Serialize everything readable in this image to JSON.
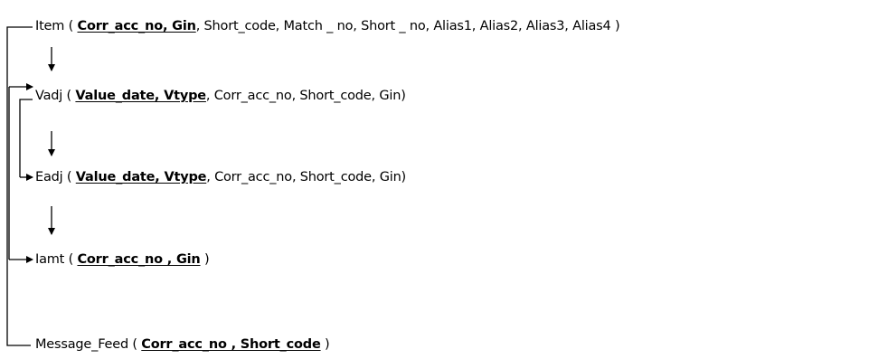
{
  "entities": [
    {
      "name": "Item",
      "key_fields": "Corr_acc_no, Gin",
      "other_fields": ", Short_code, Match _ no, Short _ no, Alias1, Alias2, Alias3, Alias4 )"
    },
    {
      "name": "Vadj",
      "key_fields": "Value_date, Vtype",
      "other_fields": ", Corr_acc_no, Short_code, Gin)"
    },
    {
      "name": "Eadj",
      "key_fields": "Value_date, Vtype",
      "other_fields": ", Corr_acc_no, Short_code, Gin)"
    },
    {
      "name": "Iamt",
      "key_fields": "Corr_acc_no , Gin",
      "other_fields": " )"
    },
    {
      "name": "Message_Feed",
      "key_fields": "Corr_acc_no , Short_code",
      "other_fields": " )"
    }
  ],
  "open_paren": " ( ",
  "colors": {
    "line": "#000000",
    "text": "#000000",
    "background": "#ffffff"
  }
}
